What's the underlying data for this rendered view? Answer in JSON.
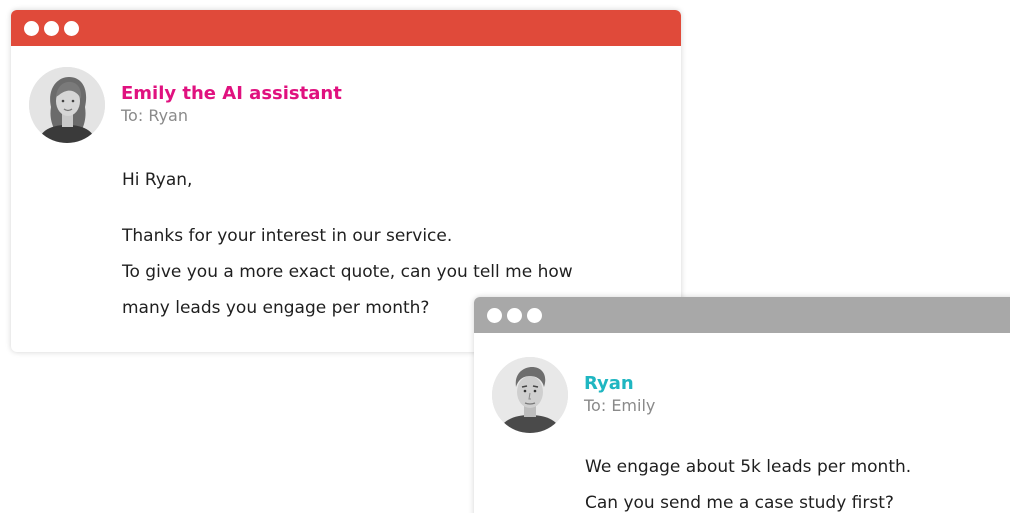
{
  "colors": {
    "emily_titlebar": "#e04a3a",
    "ryan_titlebar": "#a8a8a8",
    "emily_name": "#e0117f",
    "ryan_name": "#1fb6c1"
  },
  "emily_card": {
    "sender": "Emily the AI assistant",
    "recipient": "To: Ryan",
    "greeting": "Hi Ryan,",
    "lines": [
      "Thanks for your interest in our service.",
      "To give you a more exact quote, can you tell me how",
      "many leads you engage per month?"
    ]
  },
  "ryan_card": {
    "sender": "Ryan",
    "recipient": "To: Emily",
    "lines": [
      "We engage about 5k leads per month.",
      "Can you send me a case study first?"
    ]
  }
}
